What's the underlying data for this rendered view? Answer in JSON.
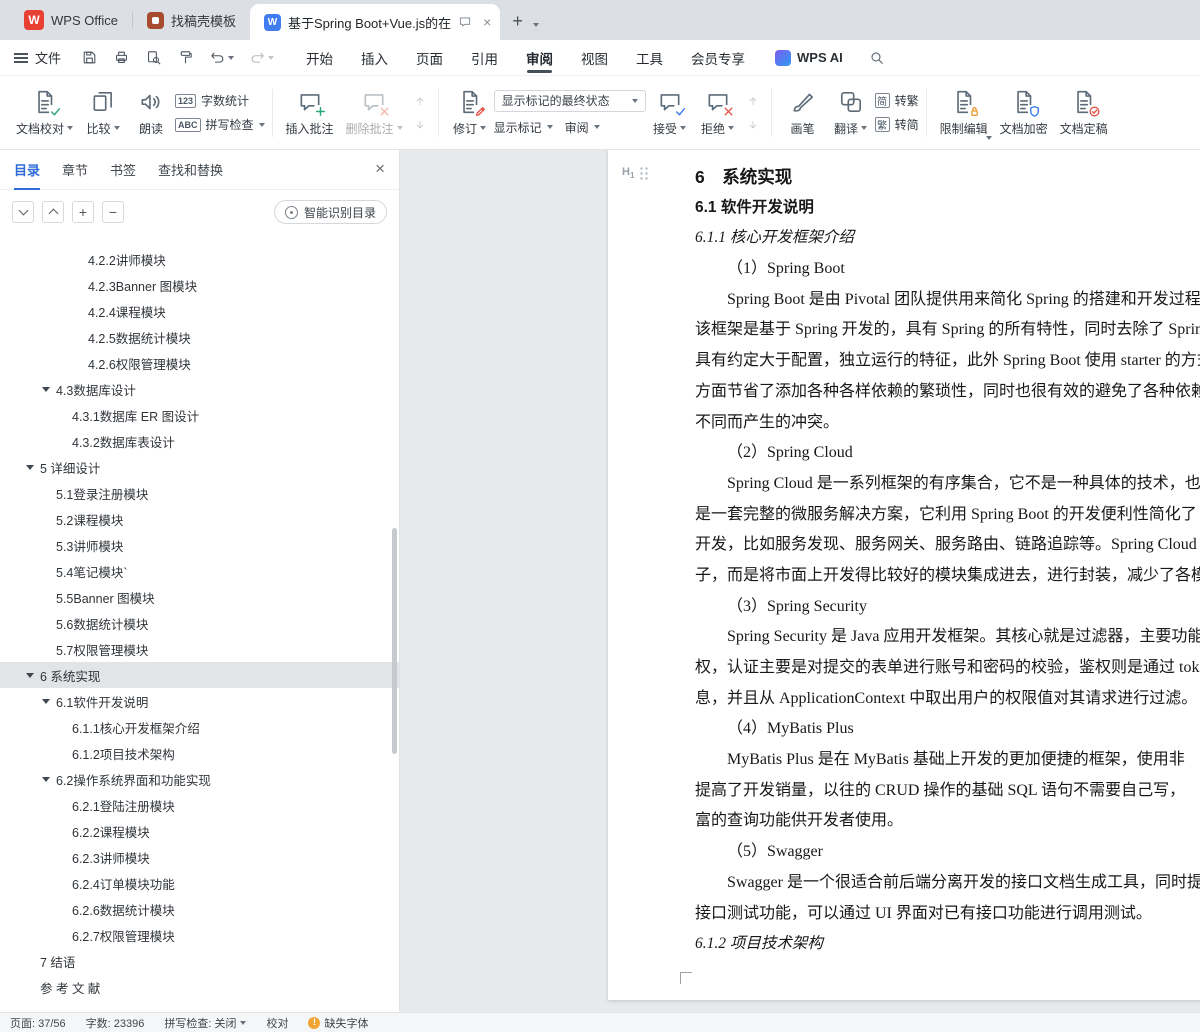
{
  "colors": {
    "accent_blue": "#2e6bd8",
    "wps_red": "#e84033",
    "doc_icon_blue": "#3f7df0",
    "warning_orange": "#f0a434",
    "toc_selected_bg": "#e2e4e7"
  },
  "tabbar": {
    "home_label": "WPS Office",
    "template_tab_label": "找稿壳模板",
    "doc_tab_label": "基于Spring Boot+Vue.js的在"
  },
  "menubar": {
    "file": "文件",
    "tabs": [
      {
        "label": "开始"
      },
      {
        "label": "插入"
      },
      {
        "label": "页面"
      },
      {
        "label": "引用"
      },
      {
        "label": "审阅",
        "active": true
      },
      {
        "label": "视图"
      },
      {
        "label": "工具"
      },
      {
        "label": "会员专享"
      }
    ],
    "wps_ai": "WPS AI"
  },
  "ribbon": {
    "doc_proof": "文档校对",
    "compare": "比较",
    "read_aloud": "朗读",
    "word_count": "字数统计",
    "word_count_icon": "123",
    "spell_check": "拼写检查",
    "spell_check_icon": "ABC",
    "insert_comment": "插入批注",
    "delete_comment": "删除批注",
    "track_changes": "修订",
    "markup_state": "显示标记的最终状态",
    "show_markup": "显示标记",
    "review": "审阅",
    "accept": "接受",
    "reject": "拒绝",
    "brush": "画笔",
    "translate": "翻译",
    "to_trad_prefix": "简",
    "to_trad": "转繁",
    "to_simp_prefix": "繁",
    "to_simp": "转简",
    "restrict_edit": "限制编辑",
    "encrypt": "文档加密",
    "finalize": "文档定稿"
  },
  "sidebar": {
    "tabs": [
      {
        "label": "目录",
        "active": true
      },
      {
        "label": "章节"
      },
      {
        "label": "书签"
      },
      {
        "label": "查找和替换"
      }
    ],
    "smart_toc": "智能识别目录",
    "toc": [
      {
        "label": "4.2.2讲师模块",
        "level": 4
      },
      {
        "label": "4.2.3Banner 图模块",
        "level": 4
      },
      {
        "label": "4.2.4课程模块",
        "level": 4
      },
      {
        "label": "4.2.5数据统计模块",
        "level": 4
      },
      {
        "label": "4.2.6权限管理模块",
        "level": 4
      },
      {
        "label": "4.3数据库设计",
        "level": 2,
        "arrow": true
      },
      {
        "label": "4.3.1数据库 ER 图设计",
        "level": 3
      },
      {
        "label": "4.3.2数据库表设计",
        "level": 3
      },
      {
        "label": "5 详细设计",
        "level": 1,
        "arrow": true
      },
      {
        "label": "5.1登录注册模块",
        "level": 2
      },
      {
        "label": "5.2课程模块",
        "level": 2
      },
      {
        "label": "5.3讲师模块",
        "level": 2
      },
      {
        "label": "5.4笔记模块`",
        "level": 2
      },
      {
        "label": "5.5Banner 图模块",
        "level": 2
      },
      {
        "label": "5.6数据统计模块",
        "level": 2
      },
      {
        "label": "5.7权限管理模块",
        "level": 2
      },
      {
        "label": "6 系统实现",
        "level": 1,
        "arrow": true,
        "selected": true
      },
      {
        "label": "6.1软件开发说明",
        "level": 2,
        "arrow": true
      },
      {
        "label": "6.1.1核心开发框架介绍",
        "level": 3
      },
      {
        "label": "6.1.2项目技术架构",
        "level": 3
      },
      {
        "label": "6.2操作系统界面和功能实现",
        "level": 2,
        "arrow": true
      },
      {
        "label": "6.2.1登陆注册模块",
        "level": 3
      },
      {
        "label": "6.2.2课程模块",
        "level": 3
      },
      {
        "label": "6.2.3讲师模块",
        "level": 3
      },
      {
        "label": "6.2.4订单模块功能",
        "level": 3
      },
      {
        "label": "6.2.6数据统计模块",
        "level": 3
      },
      {
        "label": "6.2.7权限管理模块",
        "level": 3
      },
      {
        "label": "7 结语",
        "level": 1
      },
      {
        "label": "参 考 文 献",
        "level": 1
      }
    ]
  },
  "document": {
    "heading_marker": "H",
    "heading_marker_sub": "1",
    "lines": [
      {
        "t": "h1",
        "text": "6　系统实现"
      },
      {
        "t": "h2",
        "text": "6.1  软件开发说明"
      },
      {
        "t": "h3",
        "text": "6.1.1  核心开发框架介绍"
      },
      {
        "t": "num",
        "text": "（1）Spring Boot"
      },
      {
        "t": "first",
        "text": "Spring Boot 是由 Pivotal 团队提供用来简化 Spring 的搭建和开发过程"
      },
      {
        "t": "body",
        "text": "该框架是基于 Spring 开发的，具有 Spring 的所有特性，同时去除了 Spring"
      },
      {
        "t": "body",
        "text": "具有约定大于配置，独立运行的特征，此外 Spring Boot 使用 starter 的方式"
      },
      {
        "t": "body",
        "text": "方面节省了添加各种各样依赖的繁琐性，同时也很有效的避免了各种依赖"
      },
      {
        "t": "body",
        "text": "不同而产生的冲突。"
      },
      {
        "t": "num",
        "text": "（2）Spring Cloud"
      },
      {
        "t": "first",
        "text": "Spring Cloud 是一系列框架的有序集合，它不是一种具体的技术，也"
      },
      {
        "t": "body",
        "text": "是一套完整的微服务解决方案，它利用 Spring Boot 的开发便利性简化了"
      },
      {
        "t": "body",
        "text": "开发，比如服务发现、服务网关、服务路由、链路追踪等。Spring Cloud"
      },
      {
        "t": "body",
        "text": "子，而是将市面上开发得比较好的模块集成进去，进行封装，减少了各模"
      },
      {
        "t": "num",
        "text": "（3）Spring Security"
      },
      {
        "t": "first",
        "text": "Spring Security 是 Java 应用开发框架。其核心就是过滤器，主要功能"
      },
      {
        "t": "body",
        "text": "权，认证主要是对提交的表单进行账号和密码的校验，鉴权则是通过 tok"
      },
      {
        "t": "body",
        "text": "息，并且从 ApplicationContext 中取出用户的权限值对其请求进行过滤。"
      },
      {
        "t": "num",
        "text": "（4）MyBatis Plus"
      },
      {
        "t": "first",
        "text": "MyBatis Plus 是在 MyBatis 基础上开发的更加便捷的框架，使用非"
      },
      {
        "t": "body",
        "text": "提高了开发销量，以往的 CRUD 操作的基础 SQL 语句不需要自己写，"
      },
      {
        "t": "body",
        "text": "富的查询功能供开发者使用。"
      },
      {
        "t": "num",
        "text": "（5）Swagger"
      },
      {
        "t": "first",
        "text": "Swagger 是一个很适合前后端分离开发的接口文档生成工具，同时提"
      },
      {
        "t": "body",
        "text": "接口测试功能，可以通过 UI 界面对已有接口功能进行调用测试。"
      },
      {
        "t": "h3",
        "text": "6.1.2  项目技术架构"
      }
    ]
  },
  "statusbar": {
    "page": "页面: 37/56",
    "words": "字数: 23396",
    "spell": "拼写检查: 关闭",
    "proof": "校对",
    "missing_font": "缺失字体"
  }
}
